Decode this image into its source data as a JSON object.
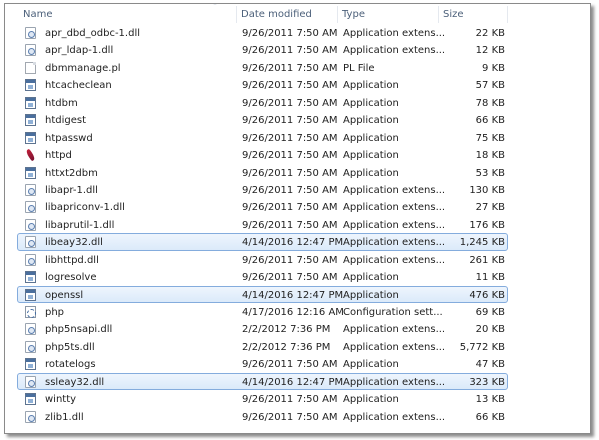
{
  "columns": {
    "name": "Name",
    "date": "Date modified",
    "type": "Type",
    "size": "Size"
  },
  "files": [
    {
      "name": "apr_dbd_odbc-1.dll",
      "date": "9/26/2011 7:50 AM",
      "type": "Application extens...",
      "size": "22 KB",
      "icon": "dll-file-icon",
      "selected": false
    },
    {
      "name": "apr_ldap-1.dll",
      "date": "9/26/2011 7:50 AM",
      "type": "Application extens...",
      "size": "12 KB",
      "icon": "dll-file-icon",
      "selected": false
    },
    {
      "name": "dbmmanage.pl",
      "date": "9/26/2011 7:50 AM",
      "type": "PL File",
      "size": "9 KB",
      "icon": "blank-file-icon",
      "selected": false
    },
    {
      "name": "htcacheclean",
      "date": "9/26/2011 7:50 AM",
      "type": "Application",
      "size": "57 KB",
      "icon": "application-icon",
      "selected": false
    },
    {
      "name": "htdbm",
      "date": "9/26/2011 7:50 AM",
      "type": "Application",
      "size": "78 KB",
      "icon": "application-icon",
      "selected": false
    },
    {
      "name": "htdigest",
      "date": "9/26/2011 7:50 AM",
      "type": "Application",
      "size": "66 KB",
      "icon": "application-icon",
      "selected": false
    },
    {
      "name": "htpasswd",
      "date": "9/26/2011 7:50 AM",
      "type": "Application",
      "size": "75 KB",
      "icon": "application-icon",
      "selected": false
    },
    {
      "name": "httpd",
      "date": "9/26/2011 7:50 AM",
      "type": "Application",
      "size": "18 KB",
      "icon": "apache-feather-icon",
      "selected": false
    },
    {
      "name": "httxt2dbm",
      "date": "9/26/2011 7:50 AM",
      "type": "Application",
      "size": "53 KB",
      "icon": "application-icon",
      "selected": false
    },
    {
      "name": "libapr-1.dll",
      "date": "9/26/2011 7:50 AM",
      "type": "Application extens...",
      "size": "130 KB",
      "icon": "dll-file-icon",
      "selected": false
    },
    {
      "name": "libapriconv-1.dll",
      "date": "9/26/2011 7:50 AM",
      "type": "Application extens...",
      "size": "27 KB",
      "icon": "dll-file-icon",
      "selected": false
    },
    {
      "name": "libaprutil-1.dll",
      "date": "9/26/2011 7:50 AM",
      "type": "Application extens...",
      "size": "176 KB",
      "icon": "dll-file-icon",
      "selected": false
    },
    {
      "name": "libeay32.dll",
      "date": "4/14/2016 12:47 PM",
      "type": "Application extens...",
      "size": "1,245 KB",
      "icon": "dll-file-icon",
      "selected": true
    },
    {
      "name": "libhttpd.dll",
      "date": "9/26/2011 7:50 AM",
      "type": "Application extens...",
      "size": "261 KB",
      "icon": "dll-file-icon",
      "selected": false
    },
    {
      "name": "logresolve",
      "date": "9/26/2011 7:50 AM",
      "type": "Application",
      "size": "11 KB",
      "icon": "application-icon",
      "selected": false
    },
    {
      "name": "openssl",
      "date": "4/14/2016 12:47 PM",
      "type": "Application",
      "size": "476 KB",
      "icon": "application-icon",
      "selected": true
    },
    {
      "name": "php",
      "date": "4/17/2016 12:16 AM",
      "type": "Configuration sett...",
      "size": "69 KB",
      "icon": "config-gear-icon",
      "selected": false
    },
    {
      "name": "php5nsapi.dll",
      "date": "2/2/2012 7:36 PM",
      "type": "Application extens...",
      "size": "20 KB",
      "icon": "dll-file-icon",
      "selected": false
    },
    {
      "name": "php5ts.dll",
      "date": "2/2/2012 7:36 PM",
      "type": "Application extens...",
      "size": "5,772 KB",
      "icon": "dll-file-icon",
      "selected": false
    },
    {
      "name": "rotatelogs",
      "date": "9/26/2011 7:50 AM",
      "type": "Application",
      "size": "47 KB",
      "icon": "application-icon",
      "selected": false
    },
    {
      "name": "ssleay32.dll",
      "date": "4/14/2016 12:47 PM",
      "type": "Application extens...",
      "size": "323 KB",
      "icon": "dll-file-icon",
      "selected": true
    },
    {
      "name": "wintty",
      "date": "9/26/2011 7:50 AM",
      "type": "Application",
      "size": "13 KB",
      "icon": "application-icon",
      "selected": false
    },
    {
      "name": "zlib1.dll",
      "date": "9/26/2011 7:50 AM",
      "type": "Application extens...",
      "size": "66 KB",
      "icon": "dll-file-icon",
      "selected": false
    }
  ]
}
